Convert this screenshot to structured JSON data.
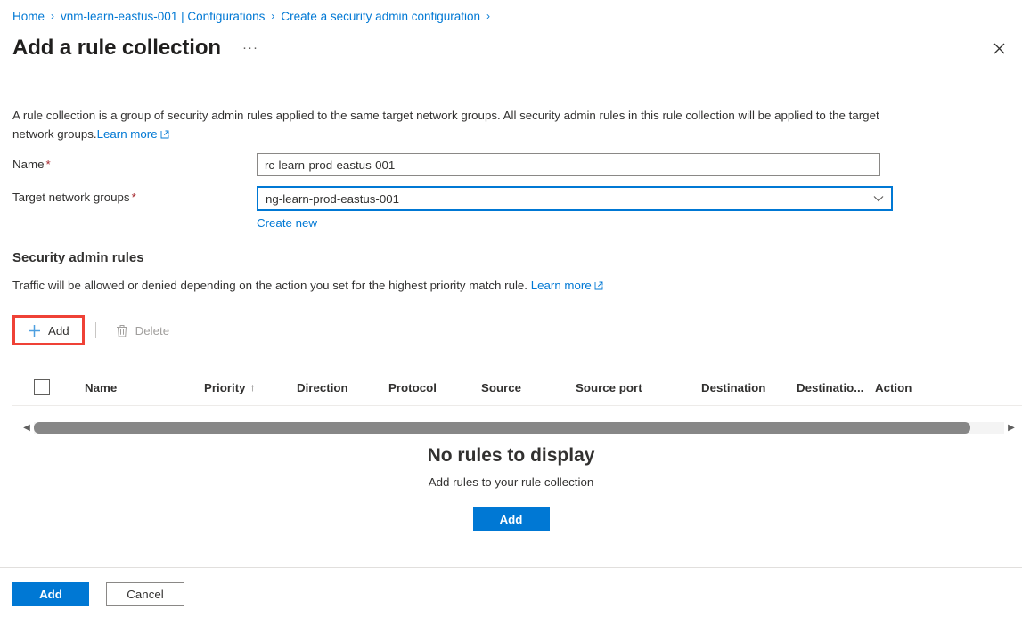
{
  "breadcrumb": {
    "items": [
      {
        "label": "Home"
      },
      {
        "label": "vnm-learn-eastus-001 | Configurations"
      },
      {
        "label": "Create a security admin configuration"
      }
    ],
    "separator": "›"
  },
  "header": {
    "title": "Add a rule collection",
    "more_menu": "···",
    "close_icon": "close-icon"
  },
  "description": {
    "text": "A rule collection is a group of security admin rules applied to the same target network groups. All security admin rules in this rule collection will be applied to the target network groups.",
    "link_label": "Learn more"
  },
  "form": {
    "name": {
      "label": "Name",
      "required": "*",
      "value": "rc-learn-prod-eastus-001",
      "placeholder": ""
    },
    "target_network_groups": {
      "label": "Target network groups",
      "required": "*",
      "value": "ng-learn-prod-eastus-001",
      "chevron": "chevron-down-icon",
      "create_new_label": "Create new"
    }
  },
  "section": {
    "heading": "Security admin rules",
    "subtitle": "Traffic will be allowed or denied depending on the action you set for the highest priority match rule.",
    "link_label": "Learn more"
  },
  "command_bar": {
    "add": {
      "label": "Add",
      "icon": "plus-icon"
    },
    "delete": {
      "label": "Delete",
      "icon": "trash-icon",
      "disabled": true
    }
  },
  "table": {
    "columns": [
      {
        "label": "Name"
      },
      {
        "label": "Priority",
        "sort": "↑"
      },
      {
        "label": "Direction"
      },
      {
        "label": "Protocol"
      },
      {
        "label": "Source"
      },
      {
        "label": "Source port"
      },
      {
        "label": "Destination"
      },
      {
        "label": "Destinatio..."
      },
      {
        "label": "Action"
      }
    ],
    "rows": []
  },
  "scrollbar": {
    "left_arrow": "◀",
    "right_arrow": "▶"
  },
  "empty_state": {
    "title": "No rules to display",
    "subtitle": "Add rules to your rule collection",
    "button_label": "Add"
  },
  "footer": {
    "primary_label": "Add",
    "secondary_label": "Cancel"
  },
  "colors": {
    "accent": "#0078d4",
    "highlight_box": "#ef4136",
    "required": "#a4262c",
    "disabled_text": "#a19f9d"
  }
}
